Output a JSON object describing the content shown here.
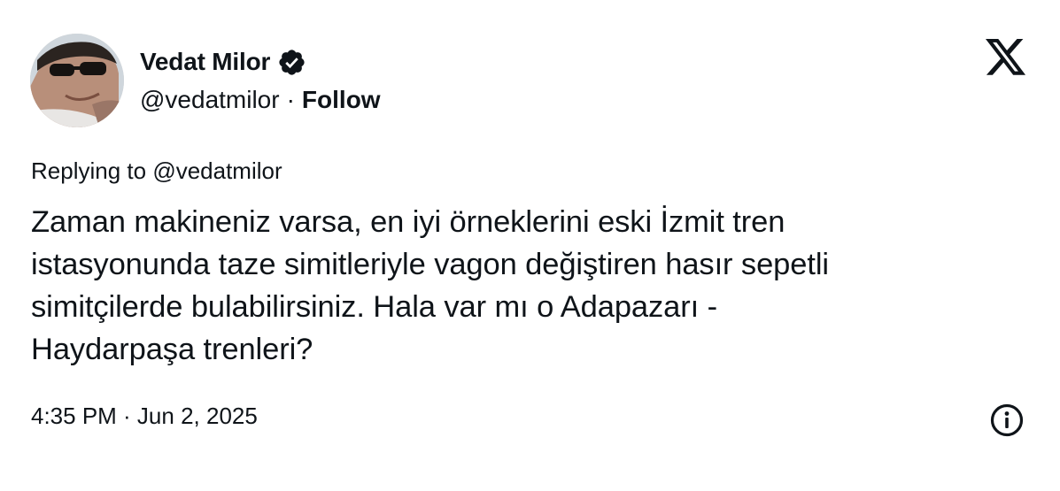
{
  "author": {
    "name": "Vedat Milor",
    "handle": "@vedatmilor",
    "separator": "·",
    "follow_label": "Follow",
    "verified": true
  },
  "brand": {
    "logo_icon": "x-logo-icon"
  },
  "reply_context": {
    "prefix": "Replying to",
    "mention": "@vedatmilor"
  },
  "tweet": {
    "text": "Zaman makineniz varsa, en iyi örneklerini eski İzmit tren\nistasyonunda taze simitleriyle vagon değiştiren hasır sepetli\nsimitçilerde bulabilirsiniz. Hala var mı o Adapazarı -\nHaydarpaşa trenleri?",
    "timestamp": "4:35 PM · Jun 2, 2025"
  },
  "icons": {
    "verified": "verified-badge-icon",
    "info": "info-icon"
  },
  "colors": {
    "text": "#0f1419",
    "background": "#ffffff"
  }
}
